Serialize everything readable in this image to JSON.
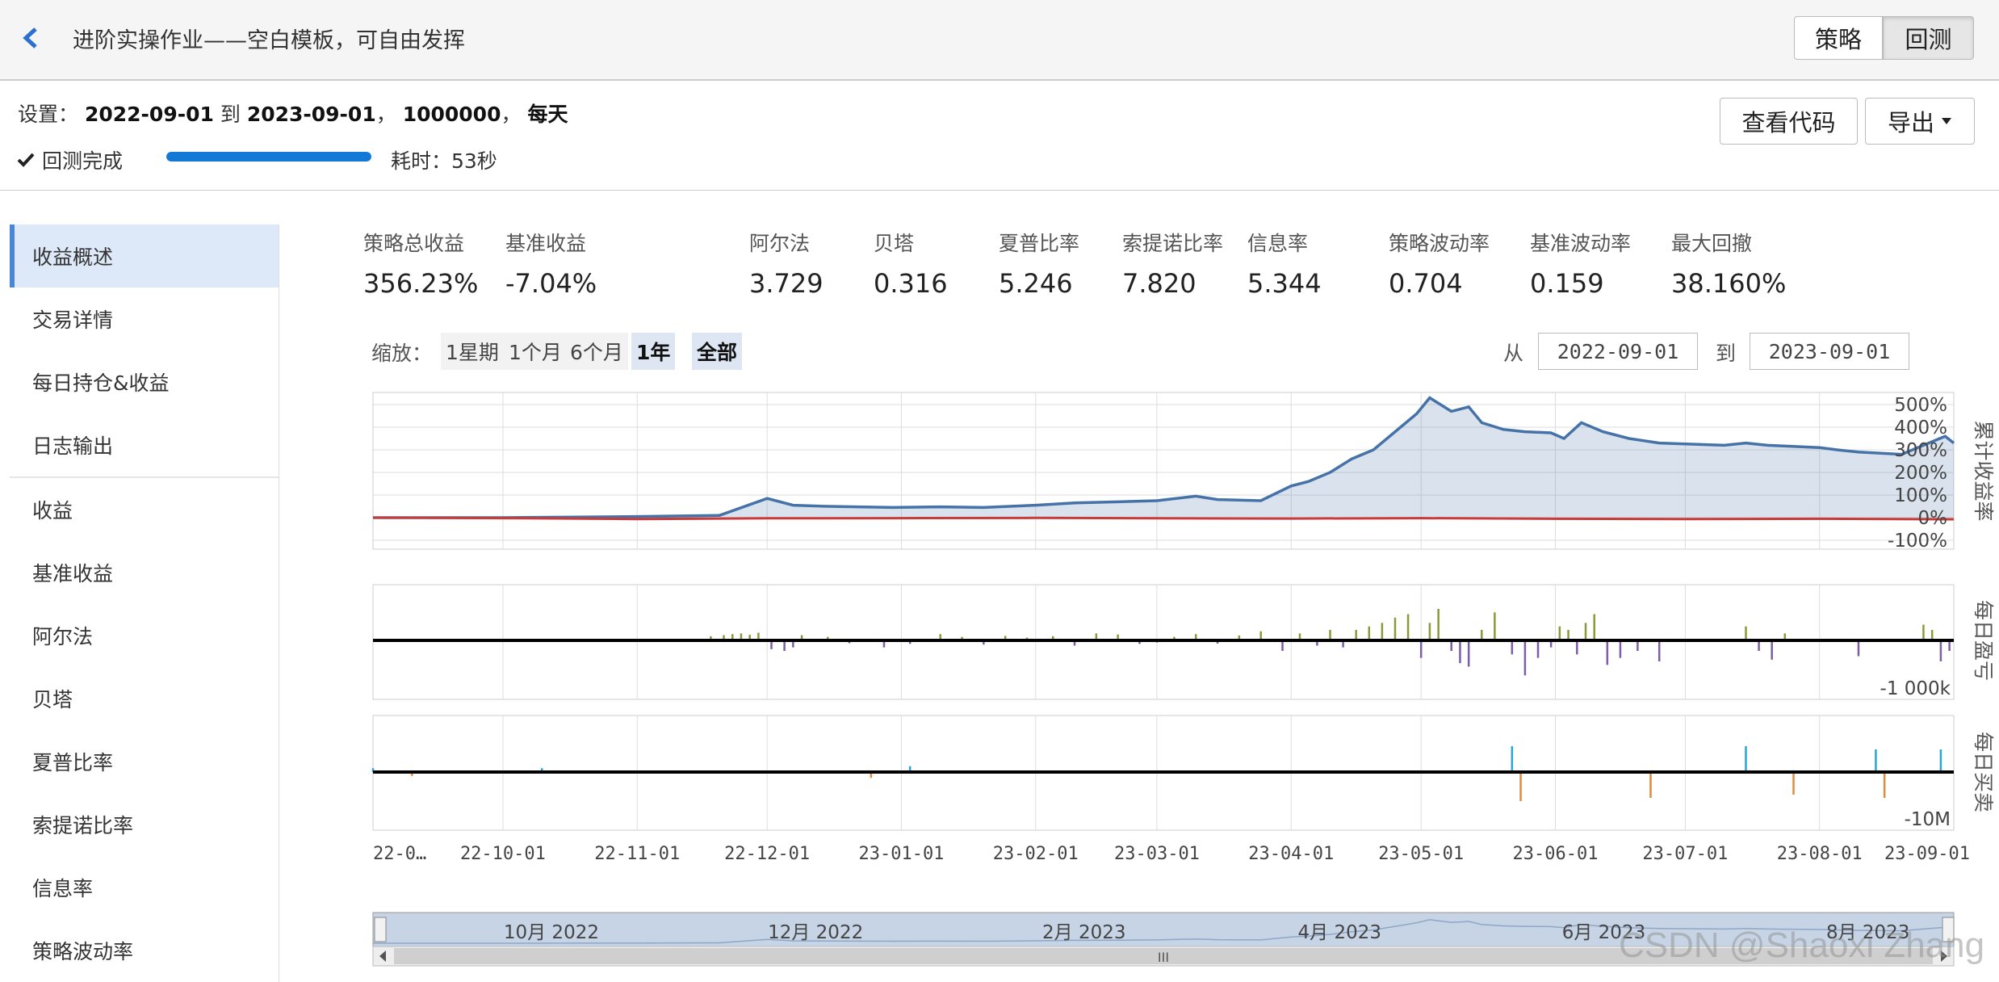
{
  "header": {
    "title": "进阶实操作业——空白模板，可自由发挥",
    "strategy_tab": "策略",
    "backtest_tab": "回测"
  },
  "settings": {
    "prefix": "设置：",
    "start": "2022-09-01",
    "to_word": "到",
    "end": "2023-09-01",
    "sep1": "，",
    "capital": "1000000",
    "sep2": "，",
    "freq": "每天",
    "status": "回测完成",
    "progress_fraction": 1.0,
    "elapsed": "耗时：53秒",
    "view_code": "查看代码",
    "export": "导出"
  },
  "sidebar": {
    "items": [
      {
        "label": "收益概述",
        "active": true
      },
      {
        "label": "交易详情"
      },
      {
        "label": "每日持仓&收益"
      },
      {
        "label": "日志输出"
      },
      {
        "label": "收益"
      },
      {
        "label": "基准收益"
      },
      {
        "label": "阿尔法"
      },
      {
        "label": "贝塔"
      },
      {
        "label": "夏普比率"
      },
      {
        "label": "索提诺比率"
      },
      {
        "label": "信息率"
      },
      {
        "label": "策略波动率"
      }
    ]
  },
  "metrics": [
    {
      "label": "策略总收益",
      "value": "356.23%"
    },
    {
      "label": "基准收益",
      "value": "-7.04%"
    },
    {
      "label": "阿尔法",
      "value": "3.729"
    },
    {
      "label": "贝塔",
      "value": "0.316"
    },
    {
      "label": "夏普比率",
      "value": "5.246"
    },
    {
      "label": "索提诺比率",
      "value": "7.820"
    },
    {
      "label": "信息率",
      "value": "5.344"
    },
    {
      "label": "策略波动率",
      "value": "0.704"
    },
    {
      "label": "基准波动率",
      "value": "0.159"
    },
    {
      "label": "最大回撤",
      "value": "38.160%"
    }
  ],
  "zoom": {
    "label": "缩放：",
    "options": [
      "1星期",
      "1个月",
      "6个月",
      "1年",
      "全部"
    ],
    "active": [
      "1年",
      "全部"
    ],
    "from_label": "从",
    "from_value": "2022-09-01",
    "to_label": "到",
    "to_value": "2023-09-01"
  },
  "chart_data": [
    {
      "type": "area",
      "title": "",
      "ylabel": "累计收益率",
      "yticks": [
        "500%",
        "400%",
        "300%",
        "200%",
        "100%",
        "0%",
        "-100%"
      ],
      "ylim": [
        -100,
        500
      ],
      "x_start": "2022-09-01",
      "x_end": "2023-09-01",
      "series": [
        {
          "color": "#4572a7",
          "x": [
            "2022-09-01",
            "2022-10-01",
            "2022-11-01",
            "2022-11-20",
            "2022-12-01",
            "2022-12-07",
            "2022-12-15",
            "2022-12-30",
            "2023-01-10",
            "2023-01-20",
            "2023-02-01",
            "2023-02-10",
            "2023-02-20",
            "2023-03-01",
            "2023-03-10",
            "2023-03-15",
            "2023-03-25",
            "2023-04-01",
            "2023-04-05",
            "2023-04-10",
            "2023-04-15",
            "2023-04-20",
            "2023-04-25",
            "2023-04-30",
            "2023-05-03",
            "2023-05-08",
            "2023-05-12",
            "2023-05-15",
            "2023-05-20",
            "2023-05-25",
            "2023-05-31",
            "2023-06-03",
            "2023-06-07",
            "2023-06-12",
            "2023-06-18",
            "2023-06-25",
            "2023-07-10",
            "2023-07-15",
            "2023-07-20",
            "2023-08-01",
            "2023-08-05",
            "2023-08-10",
            "2023-08-20",
            "2023-08-25",
            "2023-08-30",
            "2023-09-01"
          ],
          "y": [
            0,
            0,
            5,
            10,
            85,
            55,
            50,
            45,
            48,
            45,
            55,
            65,
            70,
            75,
            95,
            80,
            75,
            140,
            160,
            200,
            260,
            300,
            380,
            460,
            530,
            470,
            490,
            420,
            390,
            380,
            375,
            350,
            420,
            380,
            350,
            330,
            320,
            330,
            320,
            310,
            300,
            290,
            280,
            320,
            360,
            330
          ]
        },
        {
          "color": "#c93b3b",
          "x": [
            "2022-09-01",
            "2022-10-01",
            "2022-11-01",
            "2022-12-01",
            "2023-01-01",
            "2023-02-01",
            "2023-03-01",
            "2023-04-01",
            "2023-05-01",
            "2023-06-01",
            "2023-07-01",
            "2023-08-01",
            "2023-09-01"
          ],
          "y": [
            0,
            -2,
            -6,
            -3,
            -2,
            -1,
            -3,
            -4,
            -2,
            -5,
            -6,
            -5,
            -7
          ]
        }
      ]
    },
    {
      "type": "bar",
      "title": "",
      "ylabel": "每日盈亏",
      "ytick": "-1 000k",
      "ylim": [
        -1500,
        1500
      ],
      "dates": [
        "2022-11-18",
        "2022-11-21",
        "2022-11-23",
        "2022-11-25",
        "2022-11-27",
        "2022-11-29",
        "2022-12-02",
        "2022-12-05",
        "2022-12-07",
        "2022-12-09",
        "2022-12-15",
        "2022-12-20",
        "2022-12-28",
        "2023-01-03",
        "2023-01-10",
        "2023-01-15",
        "2023-01-20",
        "2023-01-25",
        "2023-01-30",
        "2023-02-05",
        "2023-02-10",
        "2023-02-15",
        "2023-02-20",
        "2023-02-25",
        "2023-03-01",
        "2023-03-05",
        "2023-03-10",
        "2023-03-15",
        "2023-03-20",
        "2023-03-25",
        "2023-03-30",
        "2023-04-03",
        "2023-04-07",
        "2023-04-10",
        "2023-04-13",
        "2023-04-16",
        "2023-04-19",
        "2023-04-22",
        "2023-04-25",
        "2023-04-28",
        "2023-05-01",
        "2023-05-03",
        "2023-05-05",
        "2023-05-08",
        "2023-05-10",
        "2023-05-12",
        "2023-05-15",
        "2023-05-18",
        "2023-05-22",
        "2023-05-25",
        "2023-05-28",
        "2023-05-31",
        "2023-06-02",
        "2023-06-04",
        "2023-06-06",
        "2023-06-08",
        "2023-06-10",
        "2023-06-13",
        "2023-06-16",
        "2023-06-20",
        "2023-06-25",
        "2023-07-15",
        "2023-07-18",
        "2023-07-21",
        "2023-07-24",
        "2023-08-10",
        "2023-08-25",
        "2023-08-27",
        "2023-08-29",
        "2023-08-31"
      ],
      "values": [
        120,
        150,
        180,
        200,
        160,
        220,
        -250,
        -300,
        -200,
        150,
        100,
        -80,
        -200,
        -100,
        180,
        100,
        -120,
        130,
        80,
        120,
        -150,
        200,
        170,
        -100,
        -60,
        100,
        180,
        -90,
        140,
        260,
        -300,
        200,
        -150,
        300,
        -200,
        300,
        400,
        500,
        650,
        750,
        -500,
        500,
        900,
        -300,
        -650,
        -750,
        300,
        800,
        -400,
        -1000,
        -500,
        -200,
        400,
        300,
        -400,
        500,
        750,
        -700,
        -500,
        -300,
        -600,
        400,
        -300,
        -550,
        200,
        -450,
        450,
        300,
        -600,
        -300
      ]
    },
    {
      "type": "bar",
      "title": "",
      "ylabel": "每日买卖",
      "ytick": "-10M",
      "ylim": [
        -15,
        15
      ],
      "dates": [
        "2022-09-01",
        "2022-09-10",
        "2022-10-10",
        "2022-12-25",
        "2023-01-03",
        "2023-05-22",
        "2023-05-24",
        "2023-06-23",
        "2023-07-15",
        "2023-07-26",
        "2023-08-14",
        "2023-08-16",
        "2023-08-29"
      ],
      "values": [
        2,
        -2,
        2,
        -3,
        3,
        8,
        -9,
        -8,
        8,
        -7,
        7,
        -8,
        7
      ]
    }
  ],
  "x_axis_ticks": [
    "22-0…",
    "22-10-01",
    "22-11-01",
    "22-12-01",
    "23-01-01",
    "23-02-01",
    "23-03-01",
    "23-04-01",
    "23-05-01",
    "23-06-01",
    "23-07-01",
    "23-08-01",
    "23-09-01"
  ],
  "navigator": {
    "labels": [
      "10月 2022",
      "12月 2022",
      "2月 2023",
      "4月 2023",
      "6月 2023",
      "8月 2023"
    ],
    "scroll_grip": "III"
  },
  "watermark": "CSDN @Shaoxi Zhang",
  "colors": {
    "accent": "#1279d6",
    "strategy_line": "#4572a7",
    "benchmark_line": "#c93b3b",
    "profit_bar": "#8a9a3b",
    "loss_bar": "#7b5ea7",
    "buy_bar": "#29a6d6",
    "sell_bar": "#e08a3a"
  }
}
